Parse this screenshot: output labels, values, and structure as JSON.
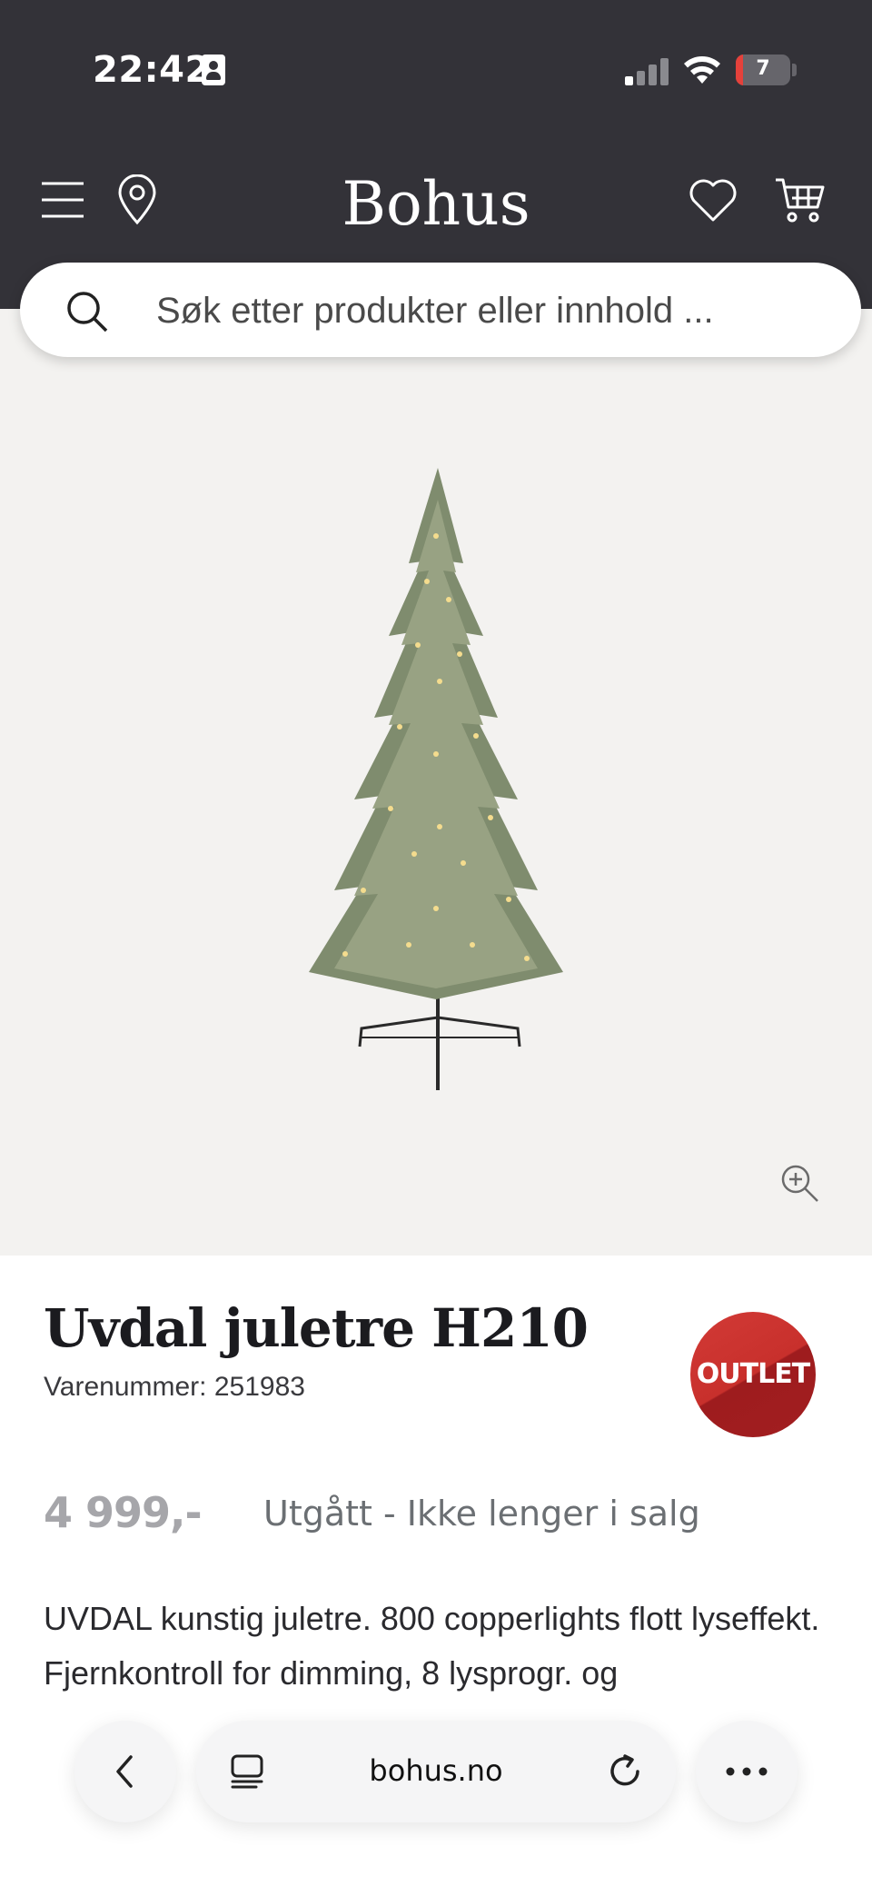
{
  "status_bar": {
    "time": "22:42",
    "battery": "7",
    "icons": [
      "id-card-icon",
      "signal-icon",
      "wifi-icon",
      "battery-icon"
    ]
  },
  "header": {
    "brand": "Bohus",
    "icons": [
      "menu-icon",
      "location-pin-icon",
      "heart-icon",
      "cart-icon"
    ],
    "background_color": "#333238"
  },
  "search": {
    "placeholder": "Søk etter produkter eller innhold ..."
  },
  "product": {
    "title": "Uvdal juletre H210",
    "sku_text": "Varenummer: 251983",
    "badge": "OUTLET",
    "price": "4 999,-",
    "availability": "Utgått - Ikke lenger i salg",
    "description": "UVDAL kunstig juletre. 800 copperlights flott lyseffekt. Fjernkontroll for dimming, 8 lysprogr. og",
    "badge_color": "#c8302c"
  },
  "browser": {
    "url": "bohus.no",
    "icons": [
      "back-icon",
      "tabs-icon",
      "reload-icon",
      "more-icon"
    ]
  }
}
